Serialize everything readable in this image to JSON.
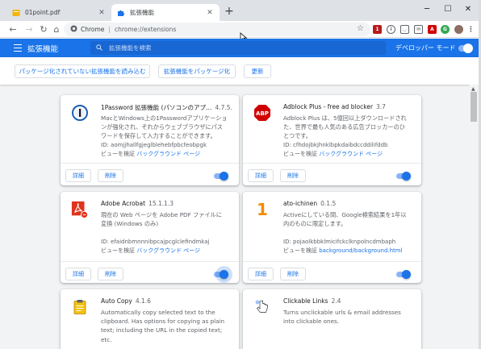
{
  "tabs": [
    {
      "title": "01point.pdf",
      "favicon": "pdf-icon"
    },
    {
      "title": "拡張機能",
      "favicon": "puzzle-icon"
    }
  ],
  "toolbar": {
    "omnibox_chip": "Chrome",
    "omnibox_url": "chrome://extensions",
    "extension_icons": [
      "1password-icon",
      "info-icon",
      "pocket-icon",
      "mail-icon",
      "adblock-icon",
      "google-icon",
      "avatar"
    ]
  },
  "header": {
    "title": "拡張機能",
    "search_placeholder": "拡張機能を検索",
    "dev_mode_label": "デベロッパー モード",
    "dev_mode_on": true
  },
  "actions": {
    "load_unpacked": "パッケージ化されていない拡張機能を読み込む",
    "pack_extension": "拡張機能をパッケージ化",
    "update": "更新"
  },
  "card_labels": {
    "details": "詳細",
    "remove": "削除",
    "inspect_views": "ビューを検証"
  },
  "extensions": [
    {
      "name": "1Password 拡張機能 (パソコンのアプ…",
      "version": "4.7.5.90",
      "description": "MacとWindows上の1Passwordアプリケーションが強化され、それからウェブブラウザにパスワードを保存して入力することができます。",
      "id_line": "ID: aomjjhallfgjeglblehebfpbcfeobpgk",
      "view_link": "バックグラウンド ページ",
      "enabled": true,
      "icon": "1password-icon"
    },
    {
      "name": "Adblock Plus - free ad blocker",
      "version": "3.7",
      "description": "Adblock Plus は、5億回以上ダウンロードされた、世界で最も人気のある広告ブロッカーのひとつです。",
      "id_line": "ID: cfhdojbkjhnklbpkdaibdccddilifddb",
      "view_link": "バックグラウンド ページ",
      "enabled": true,
      "icon": "adblock-abp-icon"
    },
    {
      "name": "Adobe Acrobat",
      "version": "15.1.1.3",
      "description": "現在の Web ページを Adobe PDF ファイルに変換 (Windows のみ)",
      "id_line": "ID: efaidnbmnnnibpcajpcglclefindmkaj",
      "view_link": "バックグラウンド ページ",
      "enabled": true,
      "icon": "adobe-acrobat-icon"
    },
    {
      "name": "ato-ichinen",
      "version": "0.1.5",
      "description": "Activeにしている間、Google検索結果を1年以内のものに限定します。",
      "id_line": "ID: pojaolkbbklmicifckclknpolncdmbaph",
      "view_link": "background/background.html",
      "enabled": true,
      "icon": "number-one-icon"
    },
    {
      "name": "Auto Copy",
      "version": "4.1.6",
      "description": "Automatically copy selected text to the clipboard. Has options for copying as plain text; including the URL in the copied text; etc.",
      "icon": "clipboard-icon"
    },
    {
      "name": "Clickable Links",
      "version": "2.4",
      "description": "Turns unclickable urls & email addresses into clickable ones.",
      "icon": "pointing-hand-icon"
    }
  ],
  "colors": {
    "accent": "#1a73e8",
    "header": "#1a73e8",
    "abp_red": "#d00000",
    "adobe_red": "#e0341e"
  }
}
